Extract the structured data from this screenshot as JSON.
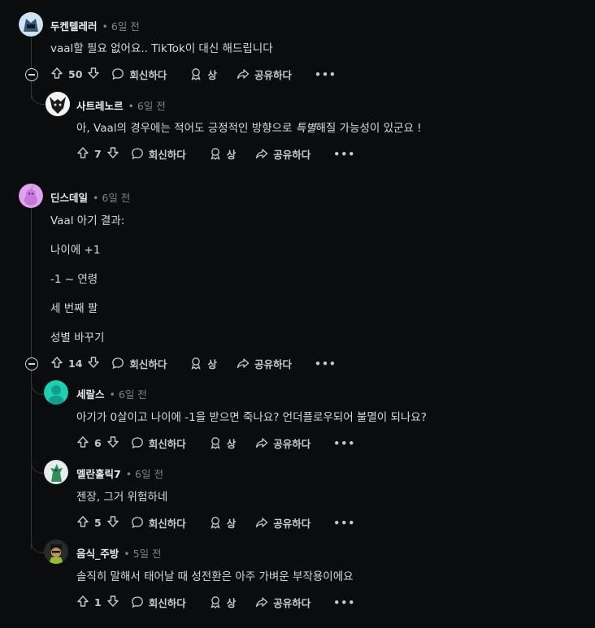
{
  "comments": [
    {
      "author": "두켄텔레러",
      "time": "• 6일 전",
      "lines": [
        "vaal할 필요 없어요.. TikTok이 대신 해드립니다"
      ],
      "votes": "50"
    },
    {
      "author": "사트레노르",
      "time": "• 6일 전",
      "text_pre": "아, Vaal의 경우에는 적어도 긍정적인 방향으로 ",
      "text_em": "특별",
      "text_post": "해질 가능성이 있군요 !",
      "votes": "7"
    },
    {
      "author": "딘스데일",
      "time": "• 6일 전",
      "lines": [
        "Vaal 아기 결과:",
        "나이에 +1",
        "-1 ~ 연령",
        "세 번째 팔",
        "성별 바꾸기"
      ],
      "votes": "14"
    },
    {
      "author": "세랄스",
      "time": "• 6일 전",
      "lines": [
        "아기가 0살이고 나이에 -1을 받으면 죽나요? 언더플로우되어 불멸이 되나요?"
      ],
      "votes": "6"
    },
    {
      "author": "멜란홀릭7",
      "time": "• 6일 전",
      "lines": [
        "젠장, 그거 위험하네"
      ],
      "votes": "5"
    },
    {
      "author": "음식_주방",
      "time": "• 5일 전",
      "lines": [
        "솔직히 말해서 태어날 때 성전환은 아주 가벼운 부작용이에요"
      ],
      "votes": "1"
    }
  ],
  "actions": {
    "reply": "회신하다",
    "award": "상",
    "share": "공유하다",
    "more": "•••"
  },
  "icons": [
    "upvote-icon",
    "downvote-icon",
    "reply-bubble-icon",
    "award-icon",
    "share-icon",
    "more-icon",
    "collapse-icon"
  ],
  "colors": {
    "background": "#0b0c0e",
    "text": "#d7dadc",
    "muted": "#818384",
    "thread_line": "#343536"
  }
}
